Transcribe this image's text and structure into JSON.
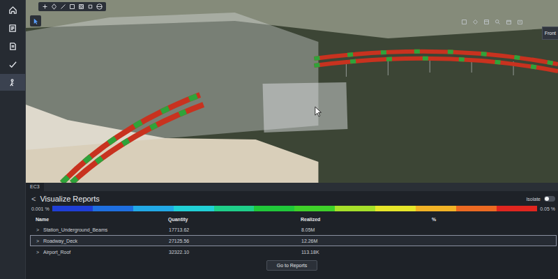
{
  "sidebar": {
    "items": [
      {
        "selected": false
      },
      {
        "selected": false
      },
      {
        "selected": false
      },
      {
        "selected": false
      },
      {
        "selected": true
      }
    ]
  },
  "viewport": {
    "view_cube_label": "Front"
  },
  "panel": {
    "tab": "EC3",
    "back_glyph": "<",
    "title": "Visualize Reports",
    "isolate": {
      "label": "Isolate",
      "on": false
    }
  },
  "legend": {
    "min": "0.001 %",
    "max": "0.05 %",
    "colors": [
      "#1f3fd6",
      "#1f6fe0",
      "#22a9e6",
      "#21d0d6",
      "#1fcf8a",
      "#20c83a",
      "#3fd12a",
      "#a6e02a",
      "#e6e62a",
      "#f2b326",
      "#ec6a22",
      "#e0261f"
    ]
  },
  "table": {
    "columns": [
      "Name",
      "Quantity",
      "Realized",
      "%"
    ],
    "rows": [
      {
        "expander": ">",
        "name": "Station_Underground_Beams",
        "quantity": "17713.62",
        "realized": "8.05M",
        "selected": false
      },
      {
        "expander": ">",
        "name": "Roadway_Deck",
        "quantity": "27125.56",
        "realized": "12.26M",
        "selected": true
      },
      {
        "expander": ">",
        "name": "Airport_Roof",
        "quantity": "32322.10",
        "realized": "113.18K",
        "selected": false
      }
    ]
  },
  "button": "Go to Reports"
}
